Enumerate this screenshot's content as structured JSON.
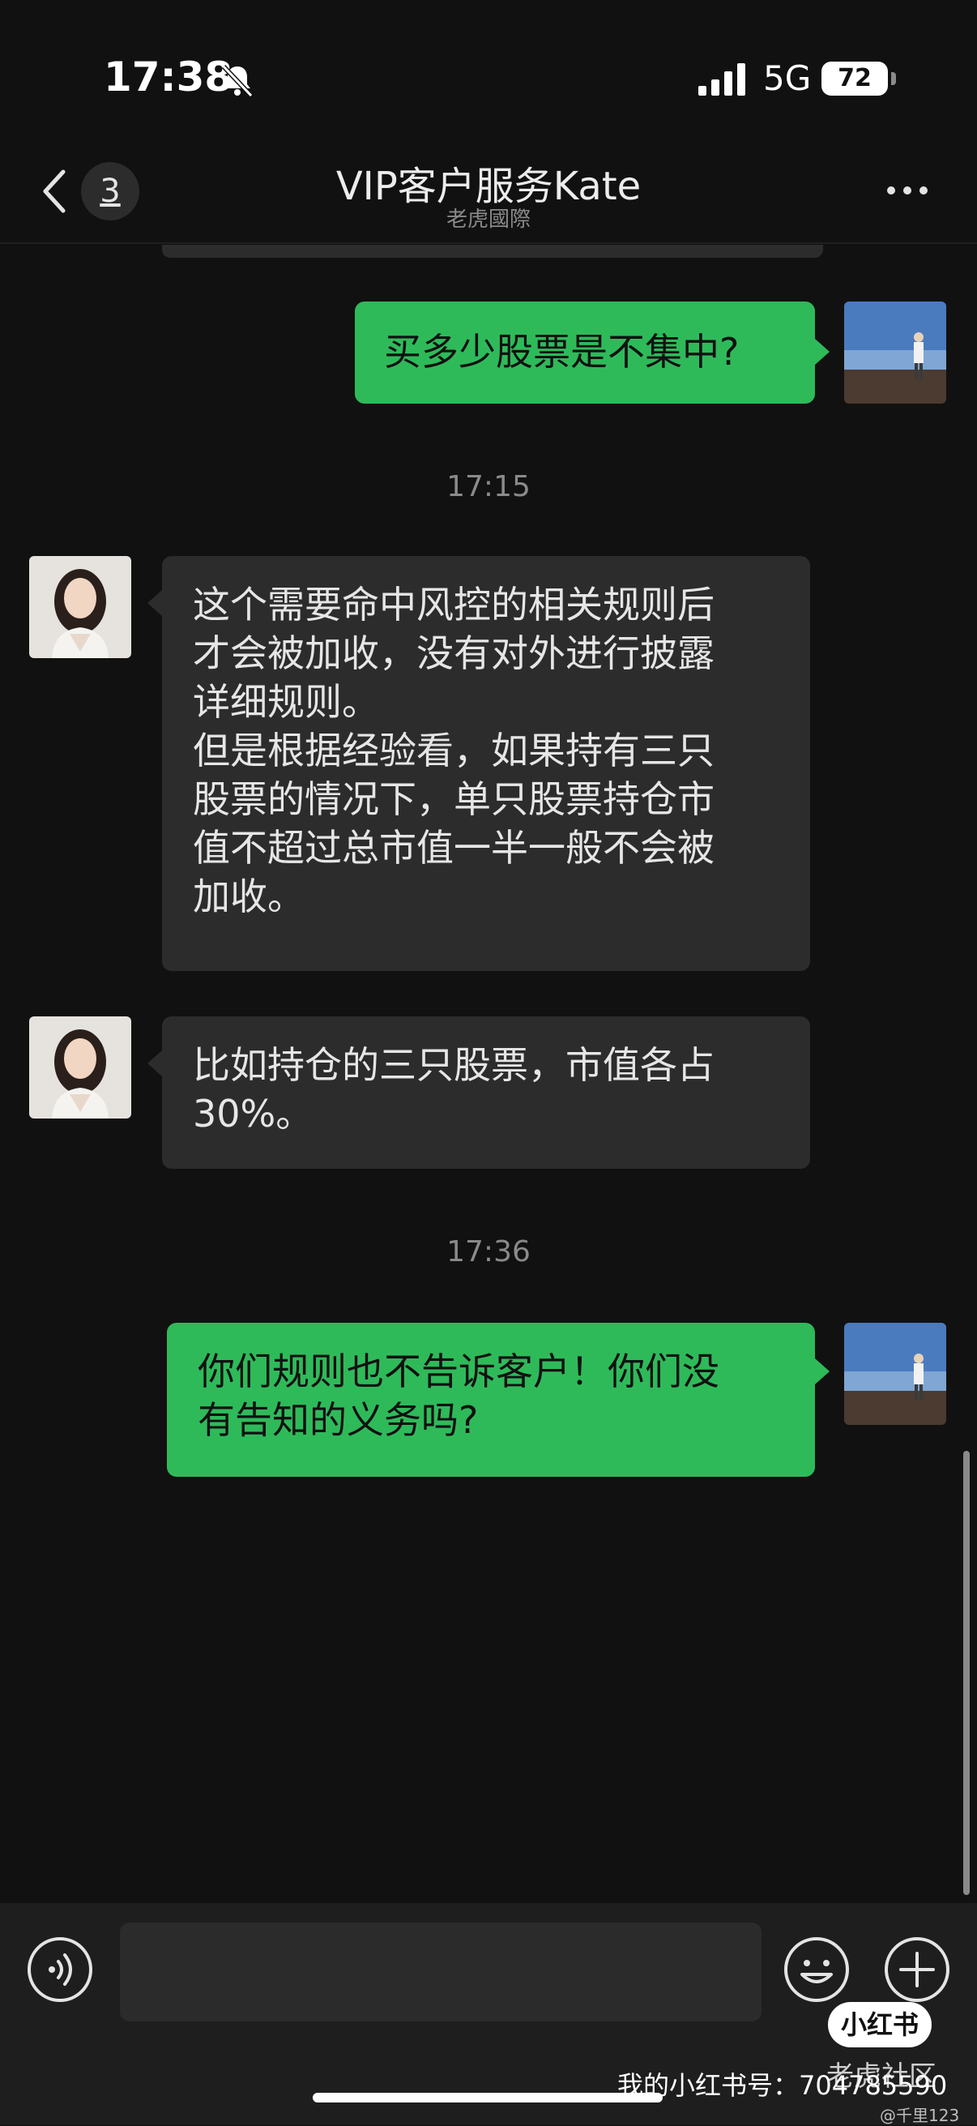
{
  "status_bar": {
    "time": "17:38",
    "network": "5G",
    "battery": "72"
  },
  "header": {
    "badge_count": "3",
    "title": "VIP客户服务Kate",
    "subtitle": "老虎國際"
  },
  "messages": [
    {
      "sender": "me",
      "text": "买多少股票是不集中?"
    },
    {
      "sender": "agent",
      "text": "这个需要命中风控的相关规则后\n才会被加收，没有对外进行披露\n详细规则。\n但是根据经验看，如果持有三只\n股票的情况下，单只股票持仓市\n值不超过总市值一半一般不会被\n加收。"
    },
    {
      "sender": "agent",
      "text": "比如持仓的三只股票，市值各占\n30%。"
    },
    {
      "sender": "me",
      "text": "你们规则也不告诉客户！你们没\n有告知的义务吗?"
    }
  ],
  "timestamps": [
    "17:15",
    "17:36"
  ],
  "input": {
    "placeholder": ""
  },
  "watermarks": {
    "logo": "小红书",
    "community": "老虎社区",
    "account": "我的小红书号：704785590",
    "user": "@千里123"
  },
  "colors": {
    "outgoing_bubble": "#2fba5a",
    "incoming_bubble": "#2c2c2c",
    "background": "#111111"
  },
  "icons": [
    "bell-slash-icon",
    "signal-icon",
    "back-chevron-icon",
    "more-icon",
    "voice-icon",
    "emoji-icon",
    "plus-icon"
  ]
}
